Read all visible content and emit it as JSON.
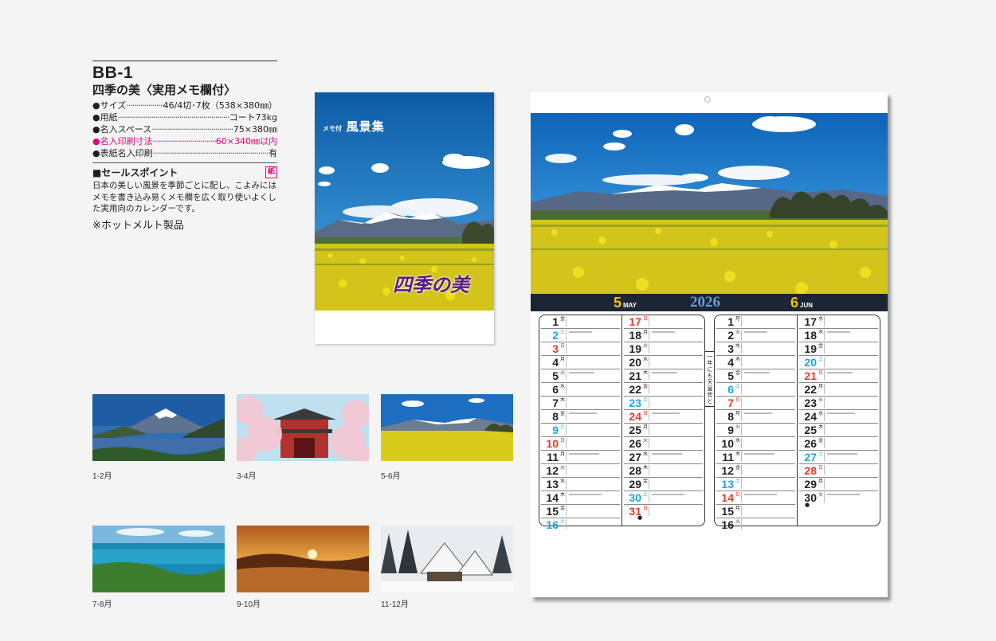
{
  "spec": {
    "code": "BB-1",
    "name": "四季の美〈実用メモ欄付〉",
    "rows": [
      {
        "label": "●サイズ",
        "dots": "······",
        "value": "46/4切･7枚（538×380㎜）",
        "highlight": false
      },
      {
        "label": "●用紙",
        "dots": "·································",
        "value": "コート73kg",
        "highlight": false
      },
      {
        "label": "●名入スペース",
        "dots": "························",
        "value": "75×380㎜",
        "highlight": false
      },
      {
        "label": "●名入印刷寸法",
        "dots": "···········",
        "value": "60×340㎜以内",
        "highlight": true
      },
      {
        "label": "●表紙名入印刷",
        "dots": "·································",
        "value": "有",
        "highlight": false
      }
    ],
    "sales_point_title": "■セールスポイント",
    "paper_badge": "紙",
    "sales_point_text": "日本の美しい風景を季節ごとに配し、こよみにはメモを書き込み易くメモ欄を広く取り使いよくした実用向のカレンダーです。",
    "note": "※ホットメルト製品"
  },
  "cover": {
    "title_small": "メモ付",
    "title_big": "風景集",
    "brand": "四季の美"
  },
  "thumbnails": [
    {
      "label": "1-2月",
      "scene": "fuji-lake"
    },
    {
      "label": "3-4月",
      "scene": "cherry-blossom-gate"
    },
    {
      "label": "5-6月",
      "scene": "rapeseed-field"
    },
    {
      "label": "7-8月",
      "scene": "ocean-coast"
    },
    {
      "label": "9-10月",
      "scene": "sunset-pampas"
    },
    {
      "label": "11-12月",
      "scene": "snowy-village"
    }
  ],
  "calendar": {
    "year": "2026",
    "months": [
      {
        "num": "5",
        "label": "MAY"
      },
      {
        "num": "6",
        "label": "JUN"
      }
    ],
    "vertical_text": "一年にも天皇皆と",
    "colors": {
      "sunday": "#e23a2d",
      "saturday": "#1ea5e0",
      "weekday": "#222222",
      "month_num": "#f2c400",
      "year": "#6a9bd8"
    },
    "may_col1": [
      {
        "d": "1",
        "w": "金"
      },
      {
        "d": "2",
        "w": "土"
      },
      {
        "d": "3",
        "w": "日"
      },
      {
        "d": "4",
        "w": "月"
      },
      {
        "d": "5",
        "w": "火"
      },
      {
        "d": "6",
        "w": "水"
      },
      {
        "d": "7",
        "w": "木"
      },
      {
        "d": "8",
        "w": "金"
      },
      {
        "d": "9",
        "w": "土"
      },
      {
        "d": "10",
        "w": "日"
      },
      {
        "d": "11",
        "w": "月"
      },
      {
        "d": "12",
        "w": "火"
      },
      {
        "d": "13",
        "w": "水"
      },
      {
        "d": "14",
        "w": "木"
      },
      {
        "d": "15",
        "w": "金"
      },
      {
        "d": "16",
        "w": "土"
      }
    ],
    "may_col2": [
      {
        "d": "17",
        "w": "日"
      },
      {
        "d": "18",
        "w": "月"
      },
      {
        "d": "19",
        "w": "火"
      },
      {
        "d": "20",
        "w": "水"
      },
      {
        "d": "21",
        "w": "木"
      },
      {
        "d": "22",
        "w": "金"
      },
      {
        "d": "23",
        "w": "土"
      },
      {
        "d": "24",
        "w": "日"
      },
      {
        "d": "25",
        "w": "月"
      },
      {
        "d": "26",
        "w": "火"
      },
      {
        "d": "27",
        "w": "水"
      },
      {
        "d": "28",
        "w": "木"
      },
      {
        "d": "29",
        "w": "金"
      },
      {
        "d": "30",
        "w": "土"
      },
      {
        "d": "31",
        "w": "日"
      }
    ],
    "jun_col1": [
      {
        "d": "1",
        "w": "月"
      },
      {
        "d": "2",
        "w": "火"
      },
      {
        "d": "3",
        "w": "水"
      },
      {
        "d": "4",
        "w": "木"
      },
      {
        "d": "5",
        "w": "金"
      },
      {
        "d": "6",
        "w": "土"
      },
      {
        "d": "7",
        "w": "日"
      },
      {
        "d": "8",
        "w": "月"
      },
      {
        "d": "9",
        "w": "火"
      },
      {
        "d": "10",
        "w": "水"
      },
      {
        "d": "11",
        "w": "木"
      },
      {
        "d": "12",
        "w": "金"
      },
      {
        "d": "13",
        "w": "土"
      },
      {
        "d": "14",
        "w": "日"
      },
      {
        "d": "15",
        "w": "月"
      },
      {
        "d": "16",
        "w": "火"
      }
    ],
    "jun_col2": [
      {
        "d": "17",
        "w": "水"
      },
      {
        "d": "18",
        "w": "木"
      },
      {
        "d": "19",
        "w": "金"
      },
      {
        "d": "20",
        "w": "土"
      },
      {
        "d": "21",
        "w": "日"
      },
      {
        "d": "22",
        "w": "月"
      },
      {
        "d": "23",
        "w": "火"
      },
      {
        "d": "24",
        "w": "水"
      },
      {
        "d": "25",
        "w": "木"
      },
      {
        "d": "26",
        "w": "金"
      },
      {
        "d": "27",
        "w": "土"
      },
      {
        "d": "28",
        "w": "日"
      },
      {
        "d": "29",
        "w": "月"
      },
      {
        "d": "30",
        "w": "火"
      }
    ]
  }
}
